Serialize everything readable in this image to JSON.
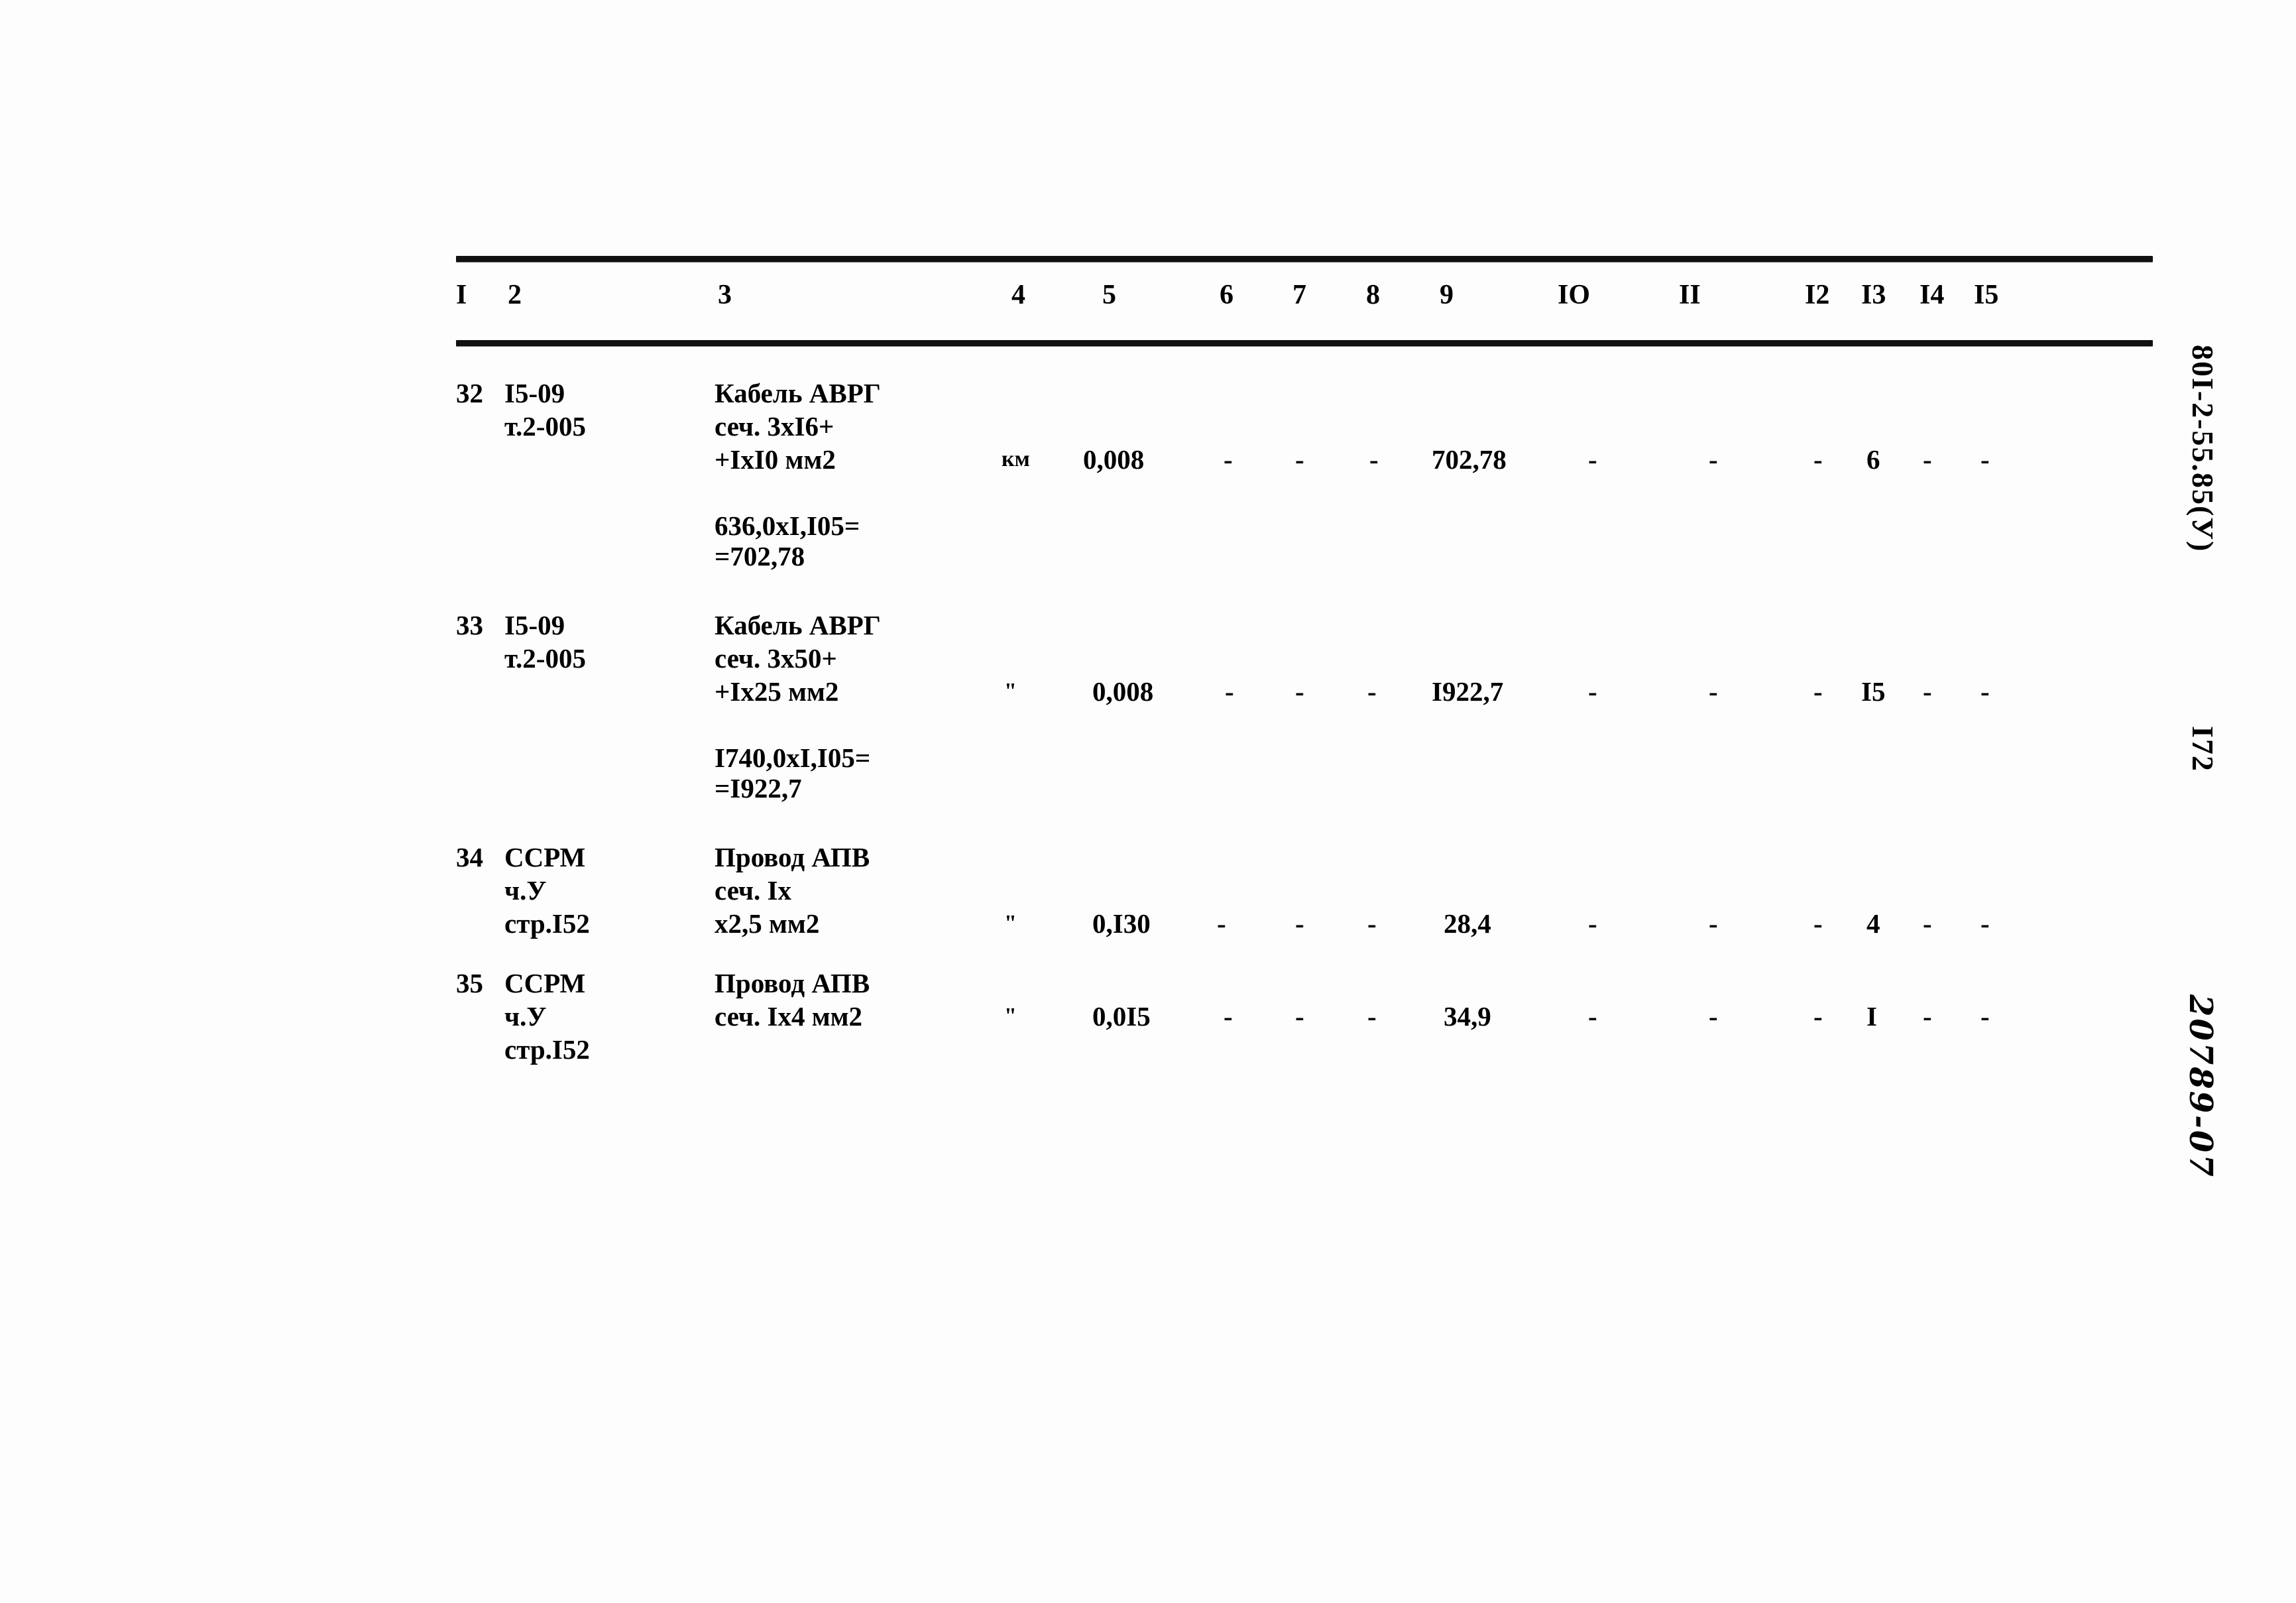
{
  "document": {
    "code": "80I-2-55.85(У)",
    "page_number": "I72",
    "archive_number": "20789-07"
  },
  "table": {
    "column_headers": [
      "I",
      "2",
      "3",
      "4",
      "5",
      "6",
      "7",
      "8",
      "9",
      "IO",
      "II",
      "I2",
      "I3",
      "I4",
      "I5"
    ],
    "rows": [
      {
        "no": "32",
        "code_lines": [
          "I5-09",
          "т.2-005"
        ],
        "name_lines": [
          "Кабель АВРГ",
          "сеч. 3хI6+",
          "+IхI0 мм2"
        ],
        "calc_lines": [
          "636,0хI,I05=",
          "=702,78"
        ],
        "unit": "км",
        "c5": "0,008",
        "c6": "-",
        "c7": "-",
        "c8": "-",
        "c9": "702,78",
        "c10": "-",
        "c11": "-",
        "c12": "-",
        "c13": "6",
        "c14": "-",
        "c15": "-"
      },
      {
        "no": "33",
        "code_lines": [
          "I5-09",
          "т.2-005"
        ],
        "name_lines": [
          "Кабель АВРГ",
          "сеч. 3х50+",
          "+Iх25 мм2"
        ],
        "calc_lines": [
          "I740,0хI,I05=",
          "=I922,7"
        ],
        "unit": "\"",
        "c5": "0,008",
        "c6": "-",
        "c7": "-",
        "c8": "-",
        "c9": "I922,7",
        "c10": "-",
        "c11": "-",
        "c12": "-",
        "c13": "I5",
        "c14": "-",
        "c15": "-"
      },
      {
        "no": "34",
        "code_lines": [
          "ССРМ",
          "ч.У",
          "стр.I52"
        ],
        "name_lines": [
          "Провод АПВ",
          "сеч. Iх",
          "х2,5 мм2"
        ],
        "calc_lines": [],
        "unit": "\"",
        "c5": "0,I30",
        "c6": "-",
        "c7": "-",
        "c8": "-",
        "c9": "28,4",
        "c10": "-",
        "c11": "-",
        "c12": "-",
        "c13": "4",
        "c14": "-",
        "c15": "-"
      },
      {
        "no": "35",
        "code_lines": [
          "ССРМ",
          "ч.У",
          "стр.I52"
        ],
        "name_lines": [
          "Провод АПВ",
          "сеч. Iх4 мм2"
        ],
        "calc_lines": [],
        "unit": "\"",
        "c5": "0,0I5",
        "c6": "-",
        "c7": "-",
        "c8": "-",
        "c9": "34,9",
        "c10": "-",
        "c11": "-",
        "c12": "-",
        "c13": "I",
        "c14": "-",
        "c15": "-"
      }
    ]
  }
}
